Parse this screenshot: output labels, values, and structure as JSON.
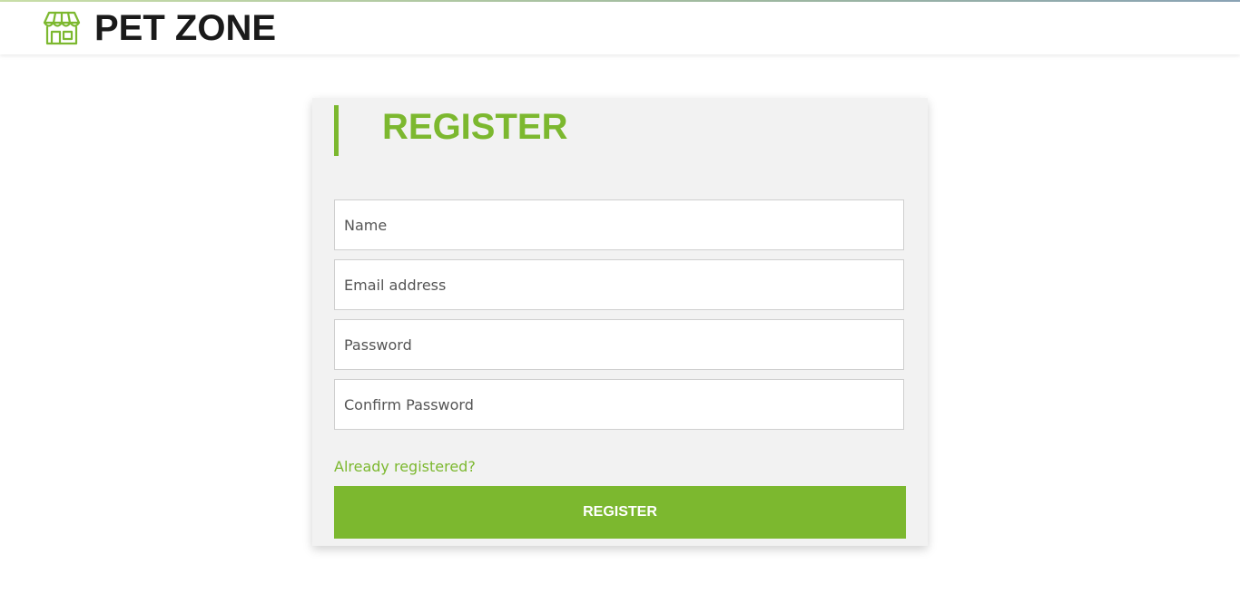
{
  "header": {
    "brand_name": "PET ZONE",
    "brand_icon": "storefront-icon",
    "accent_color": "#7cb82f"
  },
  "register": {
    "title": "REGISTER",
    "fields": {
      "name_placeholder": "Name",
      "email_placeholder": "Email address",
      "password_placeholder": "Password",
      "confirm_password_placeholder": "Confirm Password"
    },
    "login_link": "Already registered?",
    "submit_label": "REGISTER"
  }
}
